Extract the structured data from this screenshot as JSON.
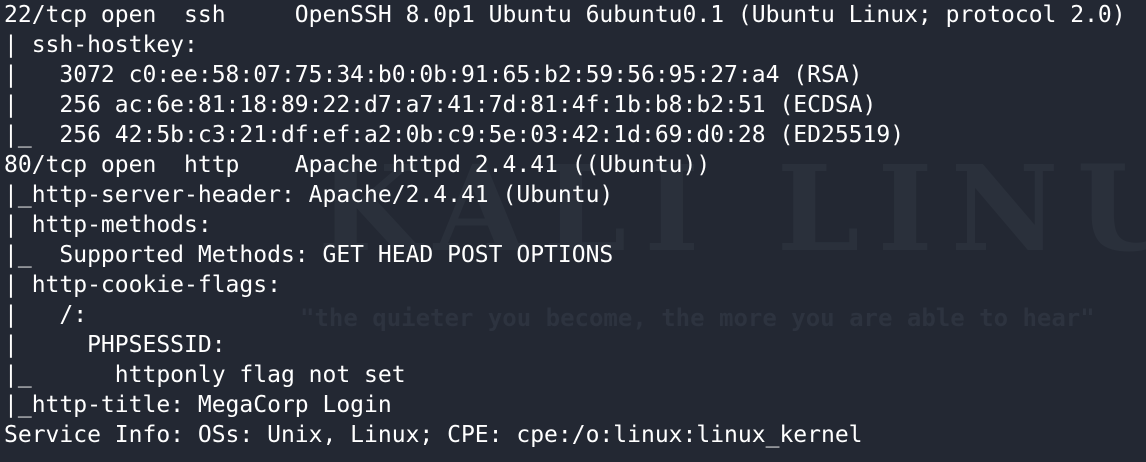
{
  "watermark": {
    "logo": "KALI LINUX",
    "tagline": "\"the quieter you become, the more you are able to hear\""
  },
  "terminal": {
    "lines": [
      "22/tcp open  ssh     OpenSSH 8.0p1 Ubuntu 6ubuntu0.1 (Ubuntu Linux; protocol 2.0)",
      "| ssh-hostkey: ",
      "|   3072 c0:ee:58:07:75:34:b0:0b:91:65:b2:59:56:95:27:a4 (RSA)",
      "|   256 ac:6e:81:18:89:22:d7:a7:41:7d:81:4f:1b:b8:b2:51 (ECDSA)",
      "|_  256 42:5b:c3:21:df:ef:a2:0b:c9:5e:03:42:1d:69:d0:28 (ED25519)",
      "80/tcp open  http    Apache httpd 2.4.41 ((Ubuntu))",
      "|_http-server-header: Apache/2.4.41 (Ubuntu)",
      "| http-methods: ",
      "|_  Supported Methods: GET HEAD POST OPTIONS",
      "| http-cookie-flags: ",
      "|   /: ",
      "|     PHPSESSID: ",
      "|_      httponly flag not set",
      "|_http-title: MegaCorp Login",
      "Service Info: OSs: Unix, Linux; CPE: cpe:/o:linux:linux_kernel"
    ]
  },
  "colors": {
    "background": "#232833",
    "text": "#ffffff",
    "watermark": "#2a303b"
  }
}
